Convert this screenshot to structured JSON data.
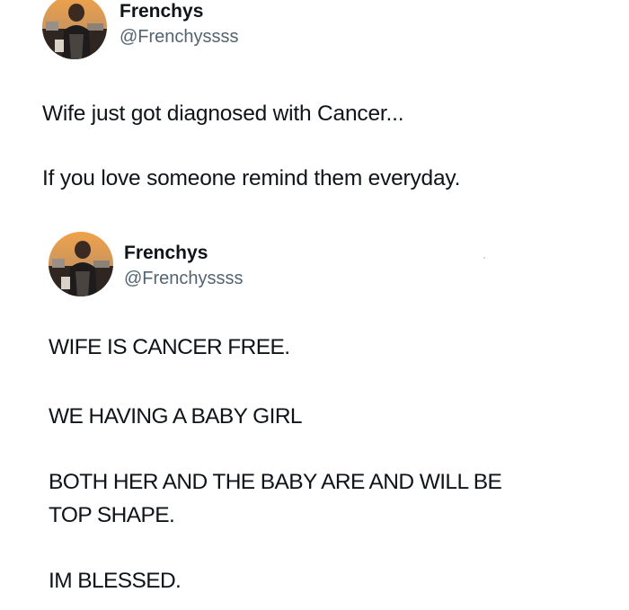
{
  "tweets": [
    {
      "author": {
        "name": "Frenchys",
        "handle": "@Frenchyssss",
        "avatar_icon": "profile-photo-icon"
      },
      "lines": [
        "Wife just got diagnosed with Cancer...",
        "If you love someone remind them everyday."
      ]
    },
    {
      "author": {
        "name": "Frenchys",
        "handle": "@Frenchyssss",
        "avatar_icon": "profile-photo-icon"
      },
      "lines": [
        "WIFE IS CANCER FREE.",
        "WE HAVING A BABY GIRL",
        "BOTH HER AND THE BABY ARE AND WILL BE",
        "TOP SHAPE.",
        "IM BLESSED."
      ]
    }
  ],
  "colors": {
    "text": "#0f1419",
    "handle": "#536471",
    "background": "#ffffff"
  }
}
